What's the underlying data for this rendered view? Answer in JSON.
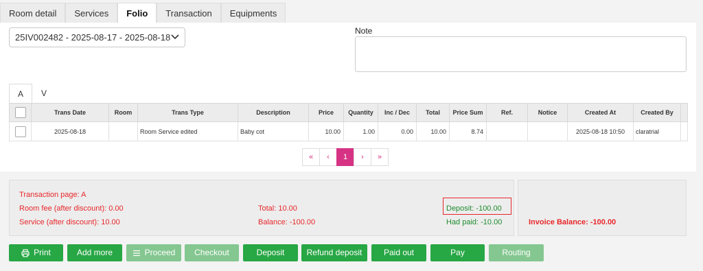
{
  "tabs": [
    {
      "label": "Room detail",
      "active": false
    },
    {
      "label": "Services",
      "active": false
    },
    {
      "label": "Folio",
      "active": true
    },
    {
      "label": "Transaction",
      "active": false
    },
    {
      "label": "Equipments",
      "active": false
    }
  ],
  "folio_select": {
    "value": "25IV002482 - 2025-08-17 - 2025-08-18",
    "icon": "chevron-down-icon"
  },
  "note": {
    "label": "Note",
    "value": ""
  },
  "subtabs": [
    {
      "label": "A",
      "active": true
    },
    {
      "label": "V",
      "active": false
    }
  ],
  "table": {
    "headers": [
      "Trans Date",
      "Room",
      "Trans Type",
      "Description",
      "Price",
      "Quantity",
      "Inc / Dec",
      "Total",
      "Price Sum",
      "Ref.",
      "Notice",
      "Created At",
      "Created By"
    ],
    "rows": [
      {
        "trans_date": "2025-08-18",
        "room": "",
        "trans_type": "Room Service edited",
        "description": "Baby cot",
        "price": "10.00",
        "quantity": "1.00",
        "inc_dec": "0.00",
        "total": "10.00",
        "price_sum": "8.74",
        "ref": "",
        "notice": "",
        "created_at": "2025-08-18 10:50",
        "created_by": "claratrial"
      }
    ]
  },
  "pagination": {
    "first": "«",
    "prev": "‹",
    "current": "1",
    "next": "›",
    "last": "»"
  },
  "summary": {
    "transaction_page": "Transaction page: A",
    "room_fee": "Room fee (after discount): 0.00",
    "service": "Service (after discount): 10.00",
    "total": "Total: 10.00",
    "balance": "Balance: -100.00",
    "deposit": "Deposit: -100.00",
    "had_paid": "Had paid: -10.00",
    "invoice_balance": "Invoice Balance: -100.00"
  },
  "buttons": {
    "print": "Print",
    "add_more": "Add more",
    "proceed": "Proceed",
    "checkout": "Checkout",
    "deposit": "Deposit",
    "refund_deposit": "Refund deposit",
    "paid_out": "Paid out",
    "pay": "Pay",
    "routing": "Routing"
  },
  "colors": {
    "accent_pink": "#d63384",
    "success_green": "#28a745",
    "danger_red": "#e8262a"
  }
}
